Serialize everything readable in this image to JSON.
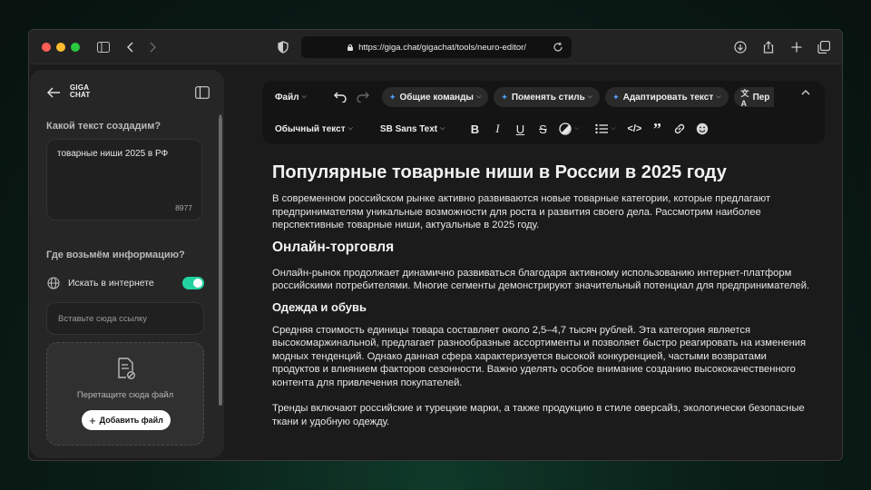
{
  "browser": {
    "url": "https://giga.chat/gigachat/tools/neuro-editor/"
  },
  "sidebar": {
    "logo_line1": "GIGA",
    "logo_line2": "CHAT",
    "prompt_label": "Какой текст создадим?",
    "prompt_value": "товарные ниши 2025 в РФ",
    "char_count": "8977",
    "source_label": "Где возьмём информацию?",
    "search_label": "Искать в интернете",
    "search_enabled": true,
    "link_placeholder": "Вставьте сюда ссылку",
    "drop_text": "Перетащите сюда файл",
    "add_file_label": "Добавить файл"
  },
  "toolbar": {
    "file_label": "Файл",
    "commands": [
      "Общие команды",
      "Поменять стиль",
      "Адаптировать текст",
      "Пер"
    ],
    "block_style": "Обычный текст",
    "font": "SB Sans Text"
  },
  "document": {
    "title": "Популярные товарные ниши в России в 2025 году",
    "intro": "В современном российском рынке активно развиваются новые товарные категории, которые предлагают предпринимателям уникальные возможности для роста и развития своего дела. Рассмотрим наиболее перспективные товарные ниши, актуальные в 2025 году.",
    "section1_title": "Онлайн-торговля",
    "section1_text": "Онлайн-рынок продолжает динамично развиваться благодаря активному использованию интернет-платформ российскими потребителями. Многие сегменты демонстрируют значительный потенциал для предпринимателей.",
    "subsection1_title": "Одежда и обувь",
    "subsection1_text": "Средняя стоимость единицы товара составляет около 2,5–4,7 тысяч рублей. Эта категория является высокомаржинальной, предлагает разнообразные ассортименты и позволяет быстро реагировать на изменения модных тенденций. Однако данная сфера характеризуется высокой конкуренцией, частыми возвратами продуктов и влиянием факторов сезонности. Важно уделять особое внимание созданию высококачественного контента для привлечения покупателей.",
    "subsection1_text2": "Тренды включают российские и турецкие марки, а также продукцию в стиле оверсайз, экологически безопасные ткани и удобную одежду."
  }
}
